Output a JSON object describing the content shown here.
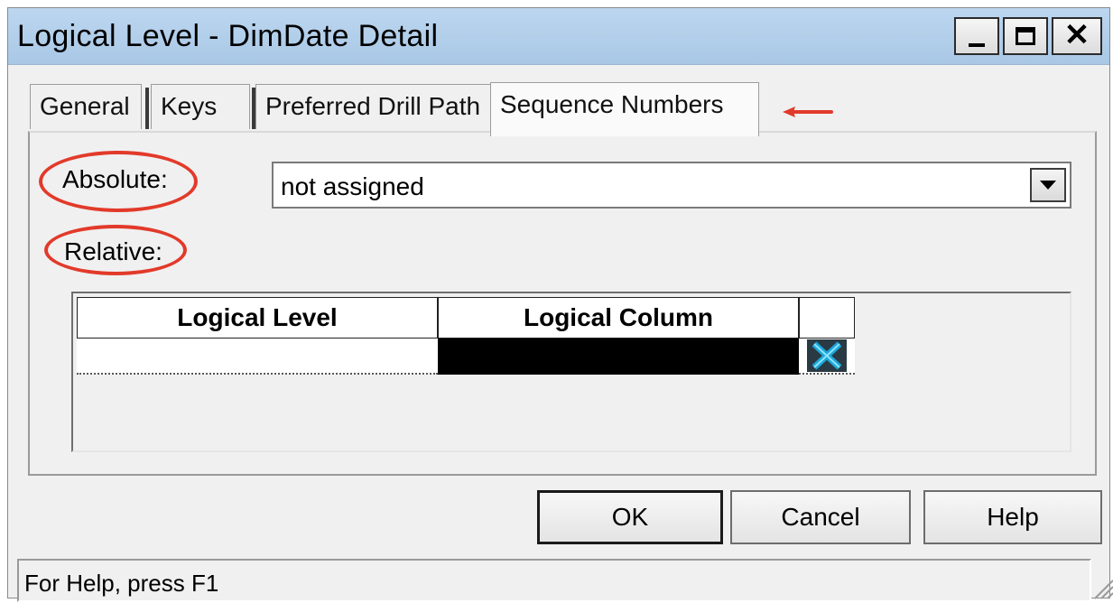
{
  "window": {
    "title": "Logical Level - DimDate Detail",
    "controls": [
      "minimize-icon",
      "maximize-icon",
      "close-icon"
    ]
  },
  "tabs": [
    {
      "label": "General",
      "active": false
    },
    {
      "label": "Keys",
      "active": false
    },
    {
      "label": "Preferred Drill Path",
      "active": false
    },
    {
      "label": "Sequence Numbers",
      "active": true
    }
  ],
  "form": {
    "absolute_label": "Absolute:",
    "absolute_value": "not assigned",
    "relative_label": "Relative:"
  },
  "grid": {
    "columns": [
      "Logical Level",
      "Logical Column",
      ""
    ],
    "rows": [
      {
        "logical_level": "",
        "logical_column": "",
        "action_icon": "delete-x-icon"
      }
    ]
  },
  "buttons": {
    "ok": "OK",
    "cancel": "Cancel",
    "help": "Help"
  },
  "status": {
    "text": "For Help, press F1"
  },
  "annotations": {
    "color": "#e23a2a",
    "highlighted": [
      "absolute-label",
      "relative-label",
      "tab-sequence-numbers"
    ]
  },
  "colors": {
    "titlebar": "#b3cfeb",
    "dialog_bg": "#f0f0f0",
    "selected_cell": "#000000",
    "delete_icon": "#1aa7d9"
  }
}
